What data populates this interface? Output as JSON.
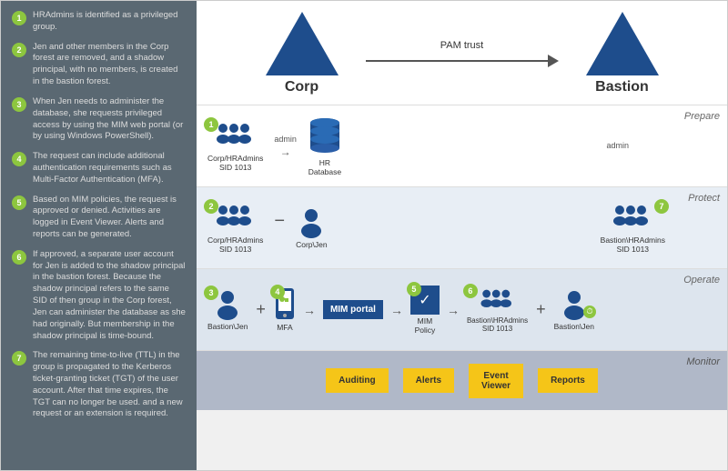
{
  "left_panel": {
    "steps": [
      {
        "num": "1",
        "text": "HRAdmins is identified as a privileged group."
      },
      {
        "num": "2",
        "text": "Jen and other members in the Corp forest are removed, and a shadow principal, with no members, is created in the bastion forest."
      },
      {
        "num": "3",
        "text": "When Jen needs to administer the database, she requests privileged access by using the MIM web portal (or by using Windows PowerShell)."
      },
      {
        "num": "4",
        "text": "The request can include additional authentication requirements such as Multi-Factor Authentication (MFA)."
      },
      {
        "num": "5",
        "text": "Based on MIM policies, the request is approved or denied. Activities are logged in Event Viewer. Alerts and reports can be generated."
      },
      {
        "num": "6",
        "text": "If approved, a separate user account for Jen is added to the shadow principal in the bastion forest. Because the shadow principal refers to the same SID of then group in the Corp forest, Jen can administer the database as she had originally. But membership in the shadow principal is time-bound."
      },
      {
        "num": "7",
        "text": "The remaining time-to-live (TTL) in the group is propagated to the Kerberos ticket-granting ticket (TGT) of the user account. After that time expires, the TGT can no longer be used. and a new request or an extension is required."
      }
    ]
  },
  "header": {
    "corp_label": "Corp",
    "bastion_label": "Bastion",
    "pam_trust_label": "PAM trust"
  },
  "sections": {
    "prepare": {
      "label": "Prepare",
      "step_num": "1",
      "group1_label": "Corp/HRAdmins\nSID 1013",
      "db_label": "HR\nDatabase",
      "admin_label1": "admin",
      "admin_label2": "admin",
      "group2_label": ""
    },
    "protect": {
      "label": "Protect",
      "step_num": "2",
      "group1_label": "Corp/HRAdmins\nSID 1013",
      "person_label": "Corp\\Jen",
      "group2_label": "Bastion\\HRAdmins\nSID 1013",
      "step7_num": "7"
    },
    "operate": {
      "label": "Operate",
      "step3_num": "3",
      "step4_num": "4",
      "step5_num": "5",
      "step6_num": "6",
      "person1_label": "Bastion\\Jen",
      "mfa_label": "MFA",
      "mim_portal_label": "MIM\nportal",
      "mim_policy_label": "MIM\nPolicy",
      "group_label": "Bastion\\HRAdmins\nSID 1013",
      "person2_label": "Bastion\\Jen"
    },
    "monitor": {
      "label": "Monitor",
      "buttons": [
        {
          "label": "Auditing"
        },
        {
          "label": "Alerts"
        },
        {
          "label": "Event\nViewer"
        },
        {
          "label": "Reports"
        }
      ]
    }
  }
}
